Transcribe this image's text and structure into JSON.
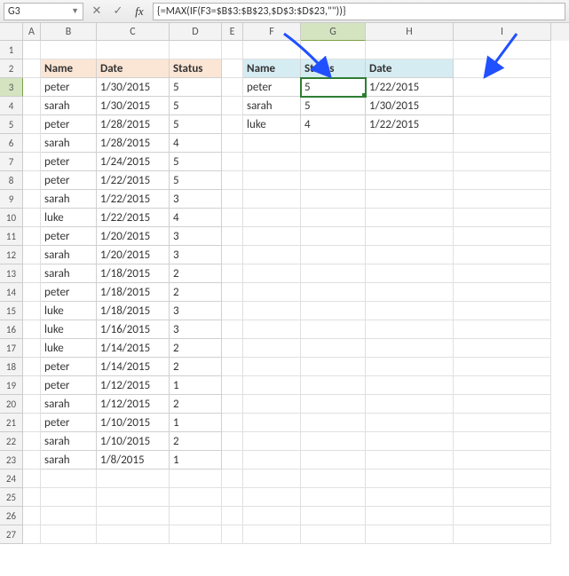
{
  "namebox": "G3",
  "formula": "{=MAX(IF(F3=$B$3:$B$23,$D$3:$D$23,\"\"))}",
  "columns": [
    "A",
    "B",
    "C",
    "D",
    "E",
    "F",
    "G",
    "H",
    "I"
  ],
  "active_col": "G",
  "active_row": "3",
  "row_numbers": [
    "1",
    "2",
    "3",
    "4",
    "5",
    "6",
    "7",
    "8",
    "9",
    "10",
    "11",
    "12",
    "13",
    "14",
    "15",
    "16",
    "17",
    "18",
    "19",
    "20",
    "21",
    "22",
    "23",
    "24",
    "25",
    "26",
    "27"
  ],
  "table1": {
    "headers": [
      "Name",
      "Date",
      "Status"
    ],
    "rows": [
      [
        "peter",
        "1/30/2015",
        "5"
      ],
      [
        "sarah",
        "1/30/2015",
        "5"
      ],
      [
        "peter",
        "1/28/2015",
        "5"
      ],
      [
        "sarah",
        "1/28/2015",
        "4"
      ],
      [
        "peter",
        "1/24/2015",
        "5"
      ],
      [
        "peter",
        "1/22/2015",
        "5"
      ],
      [
        "sarah",
        "1/22/2015",
        "3"
      ],
      [
        "luke",
        "1/22/2015",
        "4"
      ],
      [
        "peter",
        "1/20/2015",
        "3"
      ],
      [
        "sarah",
        "1/20/2015",
        "3"
      ],
      [
        "sarah",
        "1/18/2015",
        "2"
      ],
      [
        "peter",
        "1/18/2015",
        "2"
      ],
      [
        "luke",
        "1/18/2015",
        "3"
      ],
      [
        "luke",
        "1/16/2015",
        "3"
      ],
      [
        "luke",
        "1/14/2015",
        "2"
      ],
      [
        "peter",
        "1/14/2015",
        "2"
      ],
      [
        "peter",
        "1/12/2015",
        "1"
      ],
      [
        "sarah",
        "1/12/2015",
        "2"
      ],
      [
        "peter",
        "1/10/2015",
        "1"
      ],
      [
        "sarah",
        "1/10/2015",
        "2"
      ],
      [
        "sarah",
        "1/8/2015",
        "1"
      ]
    ]
  },
  "table2": {
    "headers": [
      "Name",
      "Status",
      "Date"
    ],
    "rows": [
      [
        "peter",
        "5",
        "1/22/2015"
      ],
      [
        "sarah",
        "5",
        "1/30/2015"
      ],
      [
        "luke",
        "4",
        "1/22/2015"
      ]
    ]
  }
}
